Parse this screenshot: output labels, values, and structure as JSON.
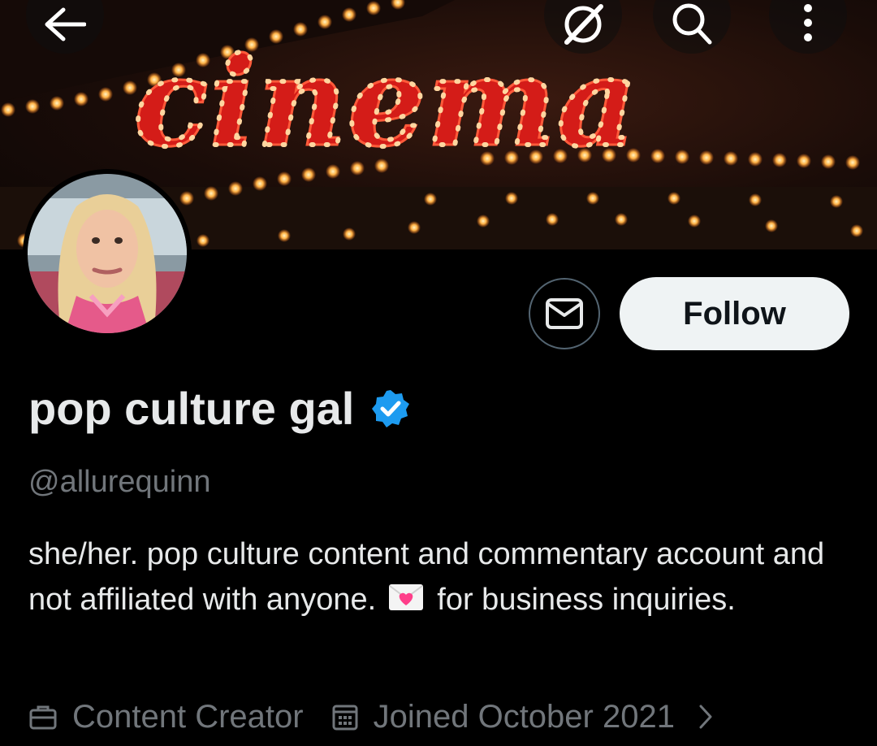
{
  "header": {
    "back_icon": "arrow-left-icon",
    "grok_icon": "grok-icon",
    "search_icon": "search-icon",
    "more_icon": "more-vertical-icon",
    "banner_sign_text": "cinema"
  },
  "actions": {
    "message_icon": "envelope-icon",
    "follow_label": "Follow"
  },
  "profile": {
    "display_name": "pop culture gal",
    "verified": true,
    "handle": "@allurequinn",
    "bio_part1": "she/her. pop culture content and commentary account and not affiliated with anyone. ",
    "bio_emoji": "love-letter-emoji",
    "bio_part2": " for business inquiries.",
    "category": "Content Creator",
    "joined": "Joined October 2021"
  },
  "colors": {
    "background": "#000000",
    "primary_text": "#e7e9ea",
    "secondary_text": "#71767b",
    "verified_blue": "#1d9bf0",
    "follow_bg": "#eff3f4",
    "neon_red": "#e0241f",
    "bulb": "#ffd27a"
  }
}
